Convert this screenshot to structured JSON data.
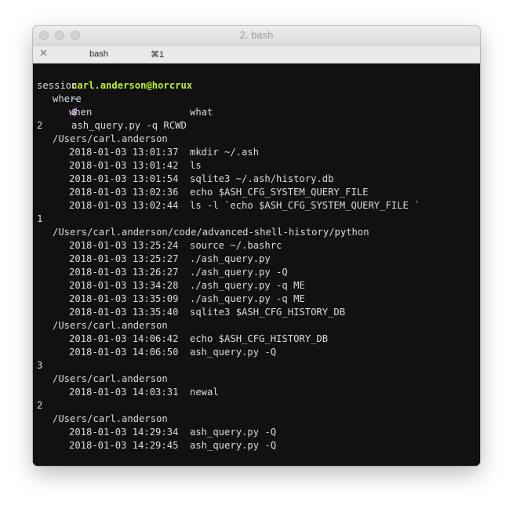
{
  "window": {
    "title": "2. bash",
    "tab_label": "bash",
    "tab_shortcut": "⌘1"
  },
  "colors": {
    "user": "#bdf22e",
    "tilde": "#55a8f2",
    "dollar": "#dc86e8",
    "background": "#111111",
    "text": "#dcdcdc"
  },
  "prompt": {
    "user_host": "carl.anderson@horcrux",
    "path": "~",
    "symbol": "$"
  },
  "first_command": "ash_query.py -q RCWD",
  "header": {
    "session": "session",
    "where": "where",
    "when": "when",
    "what": "what"
  },
  "groups": [
    {
      "session": "2",
      "dirs": [
        {
          "where": "/Users/carl.anderson",
          "rows": [
            {
              "when": "2018-01-03 13:01:37",
              "what": "mkdir ~/.ash"
            },
            {
              "when": "2018-01-03 13:01:42",
              "what": "ls"
            },
            {
              "when": "2018-01-03 13:01:54",
              "what": "sqlite3 ~/.ash/history.db"
            },
            {
              "when": "2018-01-03 13:02:36",
              "what": "echo $ASH_CFG_SYSTEM_QUERY_FILE"
            },
            {
              "when": "2018-01-03 13:02:44",
              "what": "ls -l `echo $ASH_CFG_SYSTEM_QUERY_FILE `"
            }
          ]
        }
      ]
    },
    {
      "session": "1",
      "dirs": [
        {
          "where": "/Users/carl.anderson/code/advanced-shell-history/python",
          "rows": [
            {
              "when": "2018-01-03 13:25:24",
              "what": "source ~/.bashrc"
            },
            {
              "when": "2018-01-03 13:25:27",
              "what": "./ash_query.py"
            },
            {
              "when": "2018-01-03 13:26:27",
              "what": "./ash_query.py -Q"
            },
            {
              "when": "2018-01-03 13:34:28",
              "what": "./ash_query.py -q ME"
            },
            {
              "when": "2018-01-03 13:35:09",
              "what": "./ash_query.py -q ME"
            },
            {
              "when": "2018-01-03 13:35:40",
              "what": "sqlite3 $ASH_CFG_HISTORY_DB"
            }
          ]
        },
        {
          "where": "/Users/carl.anderson",
          "rows": [
            {
              "when": "2018-01-03 14:06:42",
              "what": "echo $ASH_CFG_HISTORY_DB"
            },
            {
              "when": "2018-01-03 14:06:50",
              "what": "ash_query.py -Q"
            }
          ]
        }
      ]
    },
    {
      "session": "3",
      "dirs": [
        {
          "where": "/Users/carl.anderson",
          "rows": [
            {
              "when": "2018-01-03 14:03:31",
              "what": "newal"
            }
          ]
        }
      ]
    },
    {
      "session": "2",
      "dirs": [
        {
          "where": "/Users/carl.anderson",
          "rows": [
            {
              "when": "2018-01-03 14:29:34",
              "what": "ash_query.py -Q"
            },
            {
              "when": "2018-01-03 14:29:45",
              "what": "ash_query.py -Q"
            }
          ]
        }
      ]
    }
  ]
}
